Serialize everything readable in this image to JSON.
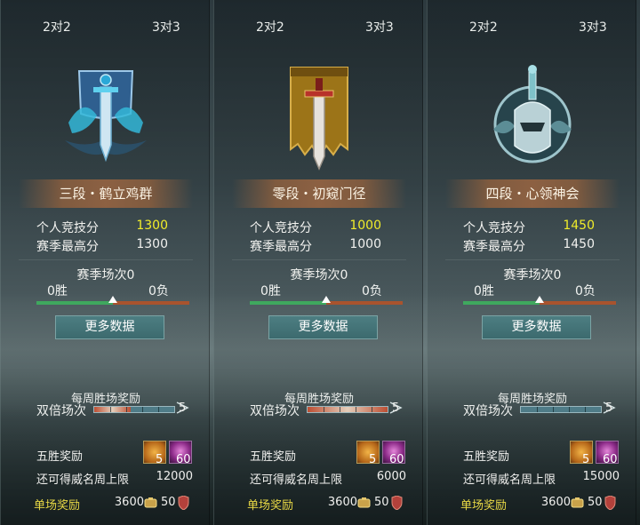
{
  "colors": {
    "accent_yellow": "#f1ec2a",
    "single_reward": "#e8d845",
    "win_bar": "#3fa85e",
    "loss_bar": "#a9532e",
    "button": "#4a7b80"
  },
  "labels": {
    "personal_score": "个人竞技分",
    "season_high": "赛季最高分",
    "more_data": "更多数据",
    "weekly_reward": "每周胜场奖励",
    "double_matches": "双倍场次",
    "five_win_reward": "五胜奖励",
    "fame_remaining": "还可得威名周上限",
    "single_reward": "单场奖励"
  },
  "panels": [
    {
      "tab_2v2": "2对2",
      "tab_3v3": "3对3",
      "emblem_icon": "blue-sword-banner-icon",
      "rank": "三段・鹤立鸡群",
      "personal_score": "1300",
      "season_high": "1300",
      "season_matches": "赛季场次0",
      "wins": "0胜",
      "losses": "0负",
      "win_ratio": 0.5,
      "double_end": "5",
      "double_filled": 0.45,
      "item1_count": "5",
      "item2_count": "60",
      "fame_remaining": "12000",
      "single_coin": "3600",
      "single_badge": "50"
    },
    {
      "tab_2v2": "2对2",
      "tab_3v3": "3对3",
      "emblem_icon": "gold-sword-banner-icon",
      "rank": "零段・初窥门径",
      "personal_score": "1000",
      "season_high": "1000",
      "season_matches": "赛季场次0",
      "wins": "0胜",
      "losses": "0负",
      "win_ratio": 0.5,
      "double_end": "5",
      "double_filled": 1.0,
      "item1_count": "5",
      "item2_count": "60",
      "fame_remaining": "6000",
      "single_coin": "3600",
      "single_badge": "50"
    },
    {
      "tab_2v2": "2对2",
      "tab_3v3": "3对3",
      "emblem_icon": "silver-helm-emblem-icon",
      "rank": "四段・心领神会",
      "personal_score": "1450",
      "season_high": "1450",
      "season_matches": "赛季场次0",
      "wins": "0胜",
      "losses": "0负",
      "win_ratio": 0.5,
      "double_end": "5",
      "double_filled": 0.0,
      "item1_count": "5",
      "item2_count": "60",
      "fame_remaining": "15000",
      "single_coin": "3600",
      "single_badge": "50"
    }
  ]
}
